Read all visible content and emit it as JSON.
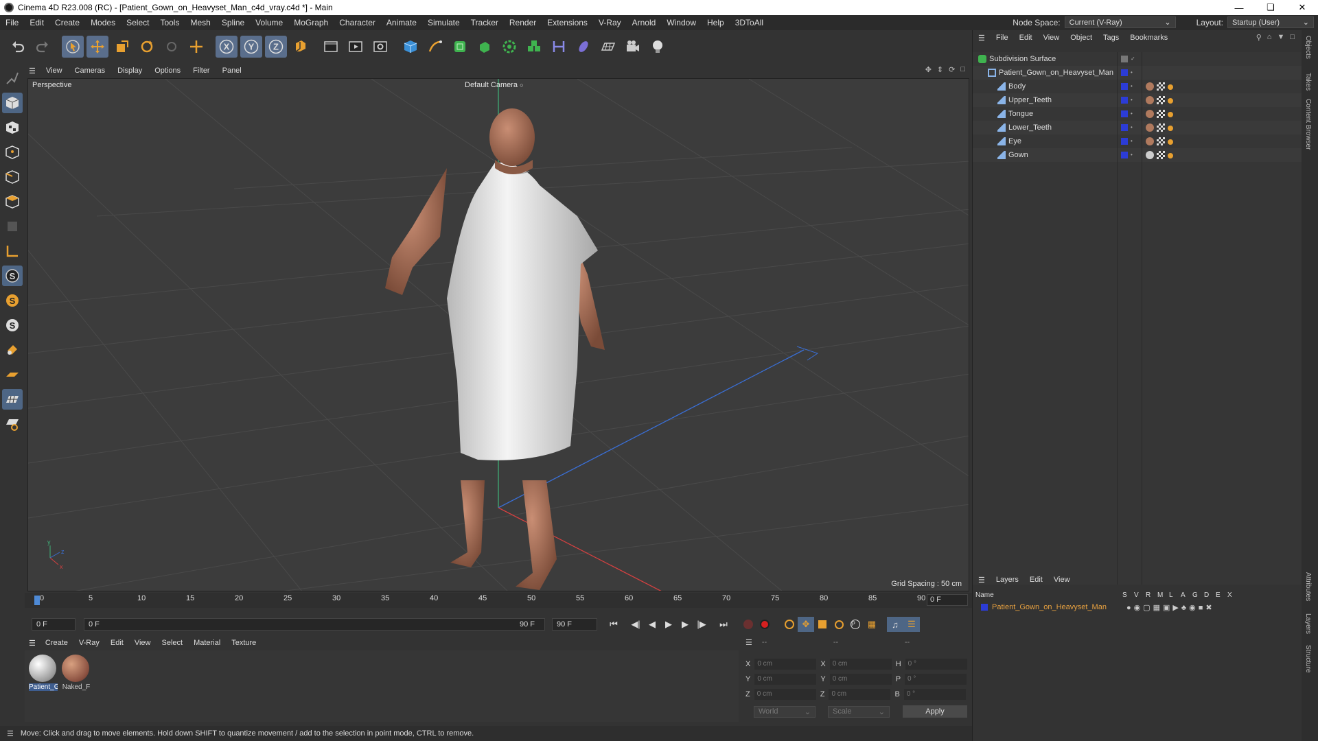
{
  "title": "Cinema 4D R23.008 (RC) - [Patient_Gown_on_Heavyset_Man_c4d_vray.c4d *] - Main",
  "menu": [
    "File",
    "Edit",
    "Create",
    "Modes",
    "Select",
    "Tools",
    "Mesh",
    "Spline",
    "Volume",
    "MoGraph",
    "Character",
    "Animate",
    "Simulate",
    "Tracker",
    "Render",
    "Extensions",
    "V-Ray",
    "Arnold",
    "Window",
    "Help",
    "3DToAll"
  ],
  "nodespace": {
    "label": "Node Space:",
    "value": "Current (V-Ray)"
  },
  "layout": {
    "label": "Layout:",
    "value": "Startup (User)"
  },
  "viewport": {
    "menu": [
      "View",
      "Cameras",
      "Display",
      "Options",
      "Filter",
      "Panel"
    ],
    "label": "Perspective",
    "camera": "Default Camera",
    "grid": "Grid Spacing : 50 cm"
  },
  "timeline": {
    "ticks": [
      "0",
      "5",
      "10",
      "15",
      "20",
      "25",
      "30",
      "35",
      "40",
      "45",
      "50",
      "55",
      "60",
      "65",
      "70",
      "75",
      "80",
      "85",
      "90"
    ],
    "current": "0 F"
  },
  "transport": {
    "start": "0 F",
    "range_start": "0 F",
    "range_end": "90 F",
    "end": "90 F"
  },
  "materials": {
    "menu": [
      "Create",
      "V-Ray",
      "Edit",
      "View",
      "Select",
      "Material",
      "Texture"
    ],
    "items": [
      {
        "label": "Patient_G",
        "color": "#cfcfcf"
      },
      {
        "label": "Naked_F",
        "color": "#b07a5e"
      }
    ]
  },
  "coords": {
    "header": [
      "--",
      "--",
      "--"
    ],
    "rows": [
      {
        "a": "X",
        "av": "0 cm",
        "b": "X",
        "bv": "0 cm",
        "c": "H",
        "cv": "0 °"
      },
      {
        "a": "Y",
        "av": "0 cm",
        "b": "Y",
        "bv": "0 cm",
        "c": "P",
        "cv": "0 °"
      },
      {
        "a": "Z",
        "av": "0 cm",
        "b": "Z",
        "bv": "0 cm",
        "c": "B",
        "cv": "0 °"
      }
    ],
    "mode1": "World",
    "mode2": "Scale",
    "apply": "Apply"
  },
  "status": "Move: Click and drag to move elements. Hold down SHIFT to quantize movement / add to the selection in point mode, CTRL to remove.",
  "objects": {
    "menu": [
      "File",
      "Edit",
      "View",
      "Object",
      "Tags",
      "Bookmarks"
    ],
    "items": [
      {
        "name": "Subdivision Surface",
        "indent": 0
      },
      {
        "name": "Patient_Gown_on_Heavyset_Man",
        "indent": 1
      },
      {
        "name": "Body",
        "indent": 2
      },
      {
        "name": "Upper_Teeth",
        "indent": 2
      },
      {
        "name": "Tongue",
        "indent": 2
      },
      {
        "name": "Lower_Teeth",
        "indent": 2
      },
      {
        "name": "Eye",
        "indent": 2
      },
      {
        "name": "Gown",
        "indent": 2
      }
    ]
  },
  "layers": {
    "menu": [
      "Layers",
      "Edit",
      "View"
    ],
    "head_name": "Name",
    "flags": [
      "S",
      "V",
      "R",
      "M",
      "L",
      "A",
      "G",
      "D",
      "E",
      "X"
    ],
    "row": "Patient_Gown_on_Heavyset_Man"
  },
  "vtabs": [
    "Objects",
    "Takes",
    "Content Browser",
    "Attributes",
    "Layers",
    "Structure"
  ],
  "colors": {
    "accent": "#4e6685",
    "layer_blue": "#2c3cd6",
    "layer_text": "#e6a040"
  }
}
